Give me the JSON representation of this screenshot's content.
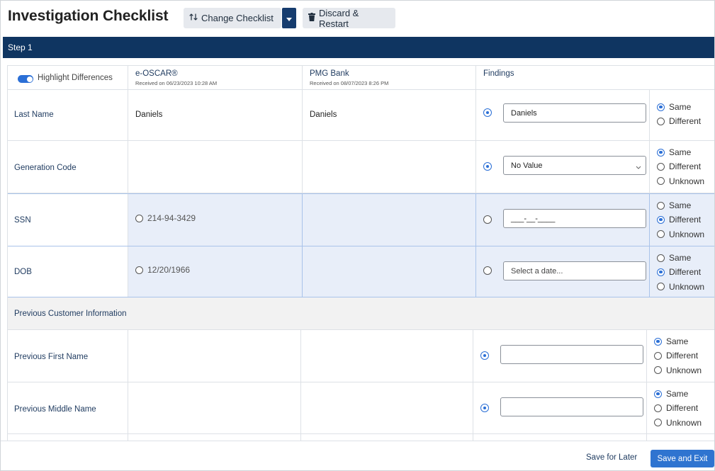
{
  "header": {
    "title": "Investigation Checklist",
    "change_checklist_label": "Change Checklist",
    "discard_label": "Discard & Restart"
  },
  "step": {
    "label": "Step 1"
  },
  "table": {
    "highlight_label": "Highlight Differences",
    "sources": [
      {
        "name": "e-OSCAR®",
        "received": "Received on 06/23/2023 10:28 AM"
      },
      {
        "name": "PMG Bank",
        "received": "Received on 08/07/2023 8:26 PM"
      }
    ],
    "findings_label": "Findings",
    "rows": [
      {
        "label": "Last Name",
        "src1": "Daniels",
        "src2": "Daniels",
        "finding_value": "Daniels",
        "finding_selected": true,
        "options": [
          "Same",
          "Different"
        ],
        "selected_option": "Same"
      },
      {
        "label": "Generation Code",
        "src1": "",
        "src2": "",
        "finding_value": "No Value",
        "finding_selected": true,
        "options": [
          "Same",
          "Different",
          "Unknown"
        ],
        "selected_option": "Same"
      },
      {
        "label": "SSN",
        "src1": "214-94-3429",
        "src2": "",
        "finding_value": "___-__-____",
        "finding_selected": false,
        "options": [
          "Same",
          "Different",
          "Unknown"
        ],
        "selected_option": "Different"
      },
      {
        "label": "DOB",
        "src1": "12/20/1966",
        "src2": "",
        "finding_placeholder": "Select a date...",
        "finding_selected": false,
        "options": [
          "Same",
          "Different",
          "Unknown"
        ],
        "selected_option": "Different"
      }
    ],
    "section_label": "Previous Customer Information",
    "prev_rows": [
      {
        "label": "Previous First Name",
        "finding_value": "",
        "finding_selected": true,
        "options": [
          "Same",
          "Different",
          "Unknown"
        ],
        "selected_option": "Same"
      },
      {
        "label": "Previous Middle Name",
        "finding_value": "",
        "finding_selected": true,
        "options": [
          "Same",
          "Different",
          "Unknown"
        ],
        "selected_option": "Same"
      }
    ]
  },
  "footer": {
    "save_later_label": "Save for Later",
    "save_exit_label": "Save and Exit"
  },
  "colors": {
    "primary": "#2f74d0",
    "navy": "#0f3561",
    "highlight": "#e8eef9"
  }
}
